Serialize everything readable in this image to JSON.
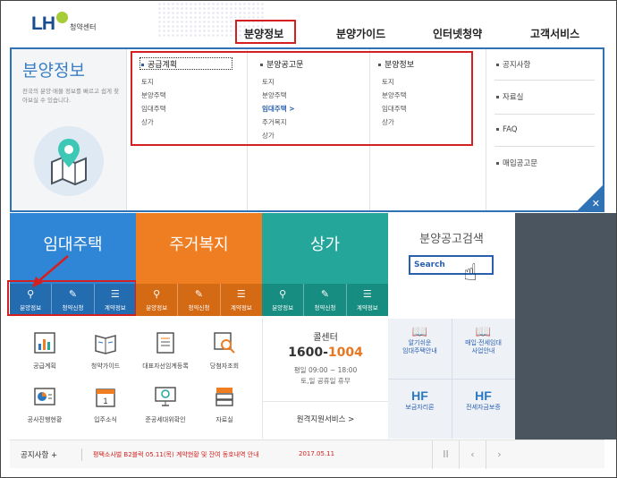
{
  "header": {
    "logo_mark": "LH",
    "logo_sub": "청약센터",
    "nav": [
      "분양정보",
      "분양가이드",
      "인터넷청약",
      "고객서비스"
    ]
  },
  "mega": {
    "title": "분양정보",
    "desc": "전국의 분양·매물 정보를 빠르고 쉽게 찾아보실 수 있습니다.",
    "col1": {
      "head": "공급계획",
      "items": [
        "토지",
        "분양주택",
        "임대주택",
        "상가"
      ]
    },
    "col2": {
      "head": "분양공고문",
      "items": [
        "토지",
        "분양주택",
        "임대주택 >",
        "주거복지",
        "상가"
      ]
    },
    "col3": {
      "head": "분양정보",
      "items": [
        "토지",
        "분양주택",
        "임대주택",
        "상가"
      ]
    },
    "right": [
      "공지사항",
      "자료실",
      "FAQ",
      "매입공고문"
    ],
    "close": "✕"
  },
  "tiles": [
    {
      "title": "임대주택",
      "color": "#2f86d6",
      "subs": [
        "분양정보",
        "청약신청",
        "계약정보"
      ]
    },
    {
      "title": "주거복지",
      "color": "#ef7d22",
      "subs": [
        "분양정보",
        "청약신청",
        "계약정보"
      ]
    },
    {
      "title": "상가",
      "color": "#24a79a",
      "subs": [
        "분양정보",
        "청약신청",
        "계약정보"
      ]
    }
  ],
  "search": {
    "title": "분양공고검색",
    "label": "Search"
  },
  "quick": [
    "공급계획",
    "청약가이드",
    "대표자선임계등록",
    "당첨자조회",
    "공사진행현황",
    "입주소식",
    "준공세대위확인",
    "자료실"
  ],
  "callcenter": {
    "title": "콜센터",
    "num_a": "1600-",
    "num_b": "1004",
    "hours": "평일 09:00 ~ 18:00",
    "holiday": "토,일 공휴일 휴무",
    "remote": "원격지원서비스  >"
  },
  "right_grid": {
    "a1": "알기쉬운",
    "a2": "임대주택안내",
    "b1": "매입·전세임대",
    "b2": "사업안내",
    "hf": "HF",
    "c1": "보금자리론",
    "d1": "전세자금보증"
  },
  "notice": {
    "label": "공지사항  +",
    "text": "평택소사벌 B2블럭 05.11(목) 계약현황 및 잔여 동호내역 안내",
    "date": "2017.05.11",
    "pause": "II",
    "prev": "‹",
    "next": "›"
  }
}
